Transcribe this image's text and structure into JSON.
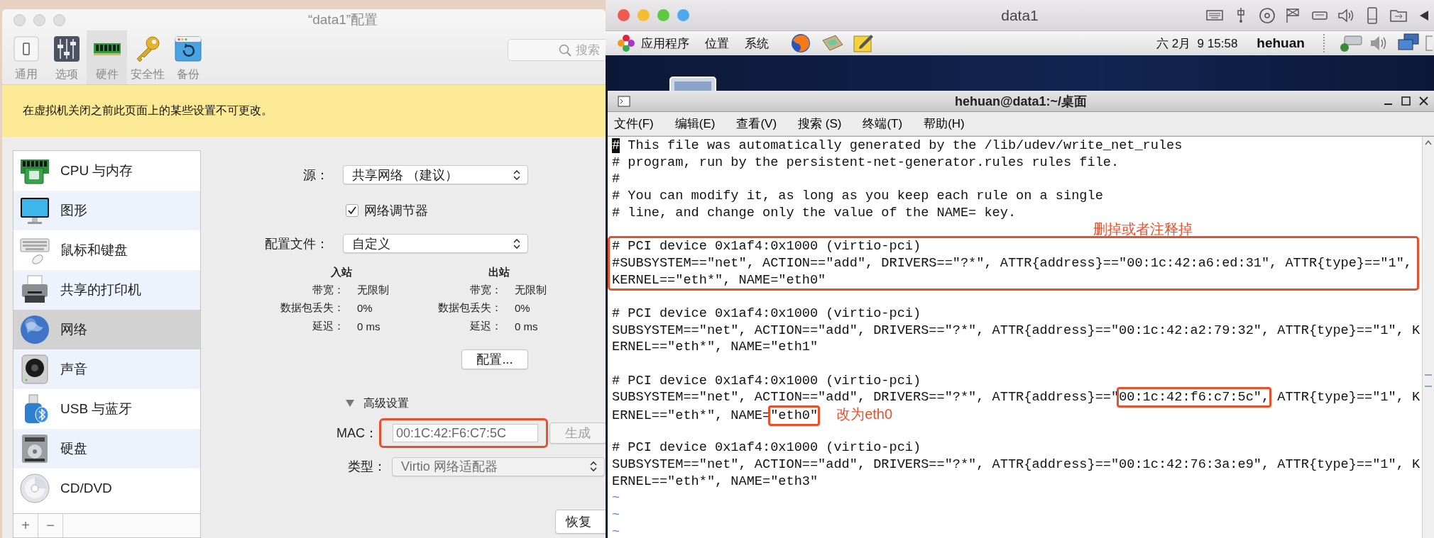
{
  "left_window": {
    "title": "“data1”配置",
    "toolbar": [
      {
        "label": "通用",
        "selected": false
      },
      {
        "label": "选项",
        "selected": false
      },
      {
        "label": "硬件",
        "selected": true
      },
      {
        "label": "安全性",
        "selected": false
      },
      {
        "label": "备份",
        "selected": false
      }
    ],
    "search": {
      "placeholder": "搜索"
    },
    "notice": "在虚拟机关闭之前此页面上的某些设置不可更改。",
    "sidebar": {
      "items": [
        {
          "label": "CPU 与内存",
          "selected": false
        },
        {
          "label": "图形",
          "selected": false
        },
        {
          "label": "鼠标和键盘",
          "selected": false
        },
        {
          "label": "共享的打印机",
          "selected": false
        },
        {
          "label": "网络",
          "selected": true
        },
        {
          "label": "声音",
          "selected": false
        },
        {
          "label": "USB 与蓝牙",
          "selected": false
        },
        {
          "label": "硬盘",
          "selected": false
        },
        {
          "label": "CD/DVD",
          "selected": false
        }
      ],
      "buttons": [
        "+",
        "−"
      ]
    },
    "network": {
      "source": {
        "label": "源：",
        "value": "共享网络 （建议）"
      },
      "conditioner": {
        "label": "网络调节器",
        "checked": true
      },
      "profile": {
        "label": "配置文件：",
        "value": "自定义"
      },
      "stats": [
        {
          "title": "入站",
          "rows": [
            {
              "label": "带宽：",
              "value": "无限制"
            },
            {
              "label": "数据包丢失：",
              "value": "0%"
            },
            {
              "label": "延迟：",
              "value": "0 ms"
            }
          ]
        },
        {
          "title": "出站",
          "rows": [
            {
              "label": "带宽：",
              "value": "无限制"
            },
            {
              "label": "数据包丢失：",
              "value": "0%"
            },
            {
              "label": "延迟：",
              "value": "0 ms"
            }
          ]
        }
      ],
      "configure_button": "配置...",
      "advanced": {
        "label": "高级设置",
        "expanded": true
      },
      "mac": {
        "label": "MAC：",
        "value": "00:1C:42:F6:C7:5C",
        "highlighted": true
      },
      "generate_button": {
        "label": "生成",
        "disabled": true
      },
      "type": {
        "label": "类型：",
        "value": "Virtio 网络适配器",
        "disabled": true
      }
    },
    "restore_button": "恢复"
  },
  "right_window": {
    "title": "data1",
    "panel": {
      "menus": [
        "应用程序",
        "位置",
        "系统"
      ],
      "clock": "六 2月  9 15:58",
      "user": "hehuan"
    },
    "terminal": {
      "title": "hehuan@data1:~/桌面",
      "menu": [
        "文件(F)",
        "编辑(E)",
        "查看(V)",
        "搜索 (S)",
        "终端(T)",
        "帮助(H)"
      ],
      "lines": [
        {
          "kind": "cursor",
          "text": "# This file was automatically generated by the /lib/udev/write_net_rules"
        },
        {
          "kind": "text",
          "text": "# program, run by the persistent-net-generator.rules rules file."
        },
        {
          "kind": "text",
          "text": "#"
        },
        {
          "kind": "text",
          "text": "# You can modify it, as long as you keep each rule on a single"
        },
        {
          "kind": "text",
          "text": "# line, and change only the value of the NAME= key."
        },
        {
          "kind": "group",
          "note": "删掉或者注释掉",
          "lines": [
            {
              "kind": "text",
              "text": "# PCI device 0x1af4:0x1000 (virtio-pci)"
            },
            {
              "kind": "text",
              "text": "#SUBSYSTEM==\"net\", ACTION==\"add\", DRIVERS==\"?*\", ATTR{address}==\"00:1c:42:a6:ed:31\", ATTR{type}==\"1\","
            },
            {
              "kind": "text",
              "text": "KERNEL==\"eth*\", NAME=\"eth0\""
            }
          ]
        },
        {
          "kind": "blank"
        },
        {
          "kind": "text",
          "text": "# PCI device 0x1af4:0x1000 (virtio-pci)"
        },
        {
          "kind": "text",
          "text": "SUBSYSTEM==\"net\", ACTION==\"add\", DRIVERS==\"?*\", ATTR{address}==\"00:1c:42:a2:79:32\", ATTR{type}==\"1\", K"
        },
        {
          "kind": "text",
          "text": "ERNEL==\"eth*\", NAME=\"eth1\""
        },
        {
          "kind": "blank"
        },
        {
          "kind": "text",
          "text": "# PCI device 0x1af4:0x1000 (virtio-pci)"
        },
        {
          "kind": "marked",
          "segments": [
            {
              "text": "SUBSYSTEM==\"net\", ACTION==\"add\", DRIVERS==\"?*\", ATTR{address}==\"",
              "boxed": false
            },
            {
              "text": "00:1c:42:f6:c7:5c\",",
              "boxed": true
            },
            {
              "text": " ATTR{type}==\"1\", K",
              "boxed": false
            }
          ]
        },
        {
          "kind": "marked",
          "segments": [
            {
              "text": "ERNEL==\"eth*\", NAME=",
              "boxed": false
            },
            {
              "text": "\"eth0\"",
              "boxed": true
            }
          ],
          "note": "改为eth0"
        },
        {
          "kind": "blank"
        },
        {
          "kind": "text",
          "text": "# PCI device 0x1af4:0x1000 (virtio-pci)"
        },
        {
          "kind": "text",
          "text": "SUBSYSTEM==\"net\", ACTION==\"add\", DRIVERS==\"?*\", ATTR{address}==\"00:1c:42:76:3a:e9\", ATTR{type}==\"1\", K"
        },
        {
          "kind": "text",
          "text": "ERNEL==\"eth*\", NAME=\"eth3\""
        },
        {
          "kind": "filler",
          "text": "~"
        },
        {
          "kind": "filler",
          "text": "~"
        },
        {
          "kind": "filler",
          "text": "~"
        }
      ]
    }
  }
}
